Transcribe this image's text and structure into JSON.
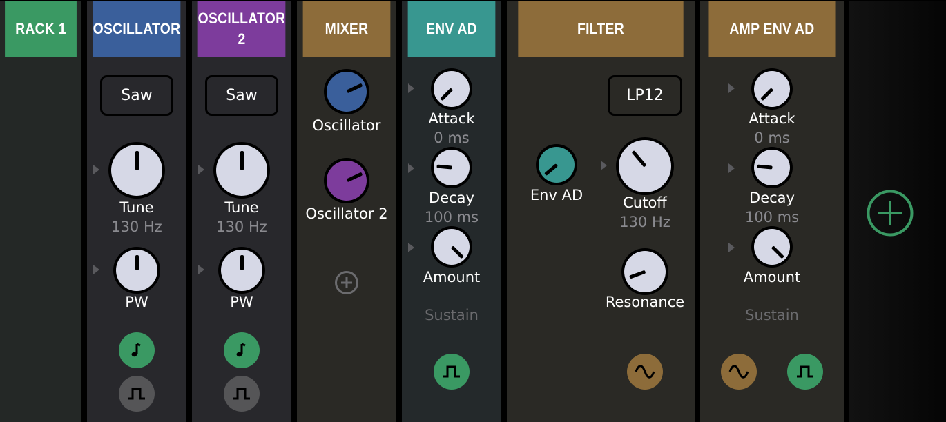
{
  "colors": {
    "green": "#3a9963",
    "blue": "#3a5f9b",
    "purple": "#7d3c9c",
    "gold": "#8d6c3a",
    "teal": "#389790",
    "knob_face": "#d6d8e6",
    "grey_button": "#555557"
  },
  "rack": {
    "title": "RACK 1"
  },
  "oscillator1": {
    "title": "OSCILLATOR",
    "waveform": "Saw",
    "tune_label": "Tune",
    "tune_value": "130 Hz",
    "pw_label": "PW",
    "note_icon": "note-icon",
    "square_icon": "square-wave-icon"
  },
  "oscillator2": {
    "title": "OSCILLATOR 2",
    "waveform": "Saw",
    "tune_label": "Tune",
    "tune_value": "130 Hz",
    "pw_label": "PW",
    "note_icon": "note-icon",
    "square_icon": "square-wave-icon"
  },
  "mixer": {
    "title": "MIXER",
    "input1_label": "Oscillator",
    "input2_label": "Oscillator 2",
    "add_icon": "plus-circle-icon"
  },
  "env_ad": {
    "title": "ENV AD",
    "attack_label": "Attack",
    "attack_value": "0 ms",
    "decay_label": "Decay",
    "decay_value": "100 ms",
    "amount_label": "Amount",
    "sustain_label": "Sustain",
    "output_icon": "square-wave-icon"
  },
  "filter": {
    "title": "FILTER",
    "mode": "LP12",
    "env_label": "Env AD",
    "cutoff_label": "Cutoff",
    "cutoff_value": "130 Hz",
    "resonance_label": "Resonance",
    "output_icon": "sine-wave-icon"
  },
  "amp_env": {
    "title": "AMP ENV AD",
    "attack_label": "Attack",
    "attack_value": "0 ms",
    "decay_label": "Decay",
    "decay_value": "100 ms",
    "amount_label": "Amount",
    "sustain_label": "Sustain",
    "input_icon": "sine-wave-icon",
    "output_icon": "square-wave-icon"
  },
  "add_module": {
    "icon": "plus-circle-icon"
  }
}
